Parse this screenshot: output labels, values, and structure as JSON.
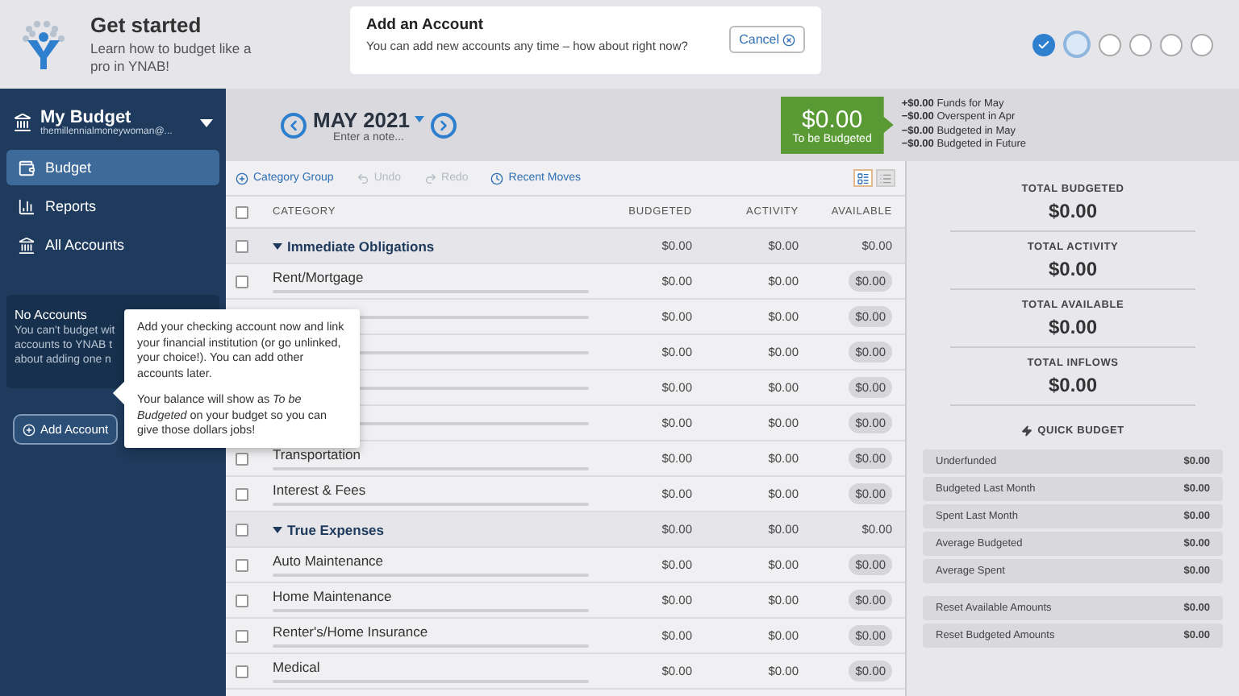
{
  "onboarding": {
    "title": "Get started",
    "subtitle": "Learn how to budget like a pro in YNAB!"
  },
  "banner": {
    "title": "Add an Account",
    "text": "You can add new accounts any time – how about right now?",
    "button": "Cancel"
  },
  "steps": [
    {
      "done": true,
      "selected": false
    },
    {
      "done": false,
      "selected": true
    },
    {
      "done": false,
      "selected": false
    },
    {
      "done": false,
      "selected": false
    },
    {
      "done": false,
      "selected": false
    },
    {
      "done": false,
      "selected": false
    }
  ],
  "sidebar": {
    "budget_name": "My Budget",
    "email": "themillennialmoneywoman@...",
    "items": [
      {
        "label": "Budget",
        "selected": true
      },
      {
        "label": "Reports",
        "selected": false
      },
      {
        "label": "All Accounts",
        "selected": false
      }
    ],
    "accounts_title": "No Accounts",
    "accounts_lines": [
      "You can't budget wit",
      "accounts to YNAB t",
      "about adding one n"
    ],
    "add_button": "Add Account"
  },
  "tooltip": {
    "paragraphs": [
      "Add your checking account now and link your financial institution (or go unlinked, your choice!). You can add other accounts later.",
      "Your balance will show as *To be Budgeted* on your budget so you can give those dollars jobs!"
    ]
  },
  "month": {
    "label": "MAY 2021",
    "note": "Enter a note..."
  },
  "to_be_budgeted": {
    "amount": "$0.00",
    "label": "To be Budgeted"
  },
  "breakdown": [
    {
      "amount": "+$0.00",
      "label": "Funds for May"
    },
    {
      "amount": "−$0.00",
      "label": "Overspent in Apr"
    },
    {
      "amount": "−$0.00",
      "label": "Budgeted in May"
    },
    {
      "amount": "−$0.00",
      "label": "Budgeted in Future"
    }
  ],
  "toolbar": [
    {
      "label": "Category Group",
      "disabled": false
    },
    {
      "label": "Undo",
      "disabled": true
    },
    {
      "label": "Redo",
      "disabled": true
    },
    {
      "label": "Recent Moves",
      "disabled": false
    }
  ],
  "view_toggle": [
    {
      "selected": true
    },
    {
      "selected": false
    }
  ],
  "table": {
    "select_all_checked": false,
    "columns": [
      "CATEGORY",
      "BUDGETED",
      "ACTIVITY",
      "AVAILABLE"
    ],
    "rows": [
      {
        "kind": "group",
        "checked": false,
        "name": "Immediate Obligations",
        "budgeted": "$0.00",
        "activity": "$0.00",
        "available": "$0.00"
      },
      {
        "kind": "category",
        "checked": false,
        "name": "Rent/Mortgage",
        "budgeted": "$0.00",
        "activity": "$0.00",
        "available": "$0.00"
      },
      {
        "kind": "category",
        "budgeted": "$0.00",
        "activity": "$0.00",
        "available": "$0.00"
      },
      {
        "kind": "category",
        "budgeted": "$0.00",
        "activity": "$0.00",
        "available": "$0.00"
      },
      {
        "kind": "category",
        "budgeted": "$0.00",
        "activity": "$0.00",
        "available": "$0.00"
      },
      {
        "kind": "category",
        "budgeted": "$0.00",
        "activity": "$0.00",
        "available": "$0.00"
      },
      {
        "kind": "category",
        "checked": false,
        "name": "Transportation",
        "budgeted": "$0.00",
        "activity": "$0.00",
        "available": "$0.00"
      },
      {
        "kind": "category",
        "checked": false,
        "name": "Interest & Fees",
        "budgeted": "$0.00",
        "activity": "$0.00",
        "available": "$0.00"
      },
      {
        "kind": "group",
        "checked": false,
        "name": "True Expenses",
        "budgeted": "$0.00",
        "activity": "$0.00",
        "available": "$0.00"
      },
      {
        "kind": "category",
        "checked": false,
        "name": "Auto Maintenance",
        "budgeted": "$0.00",
        "activity": "$0.00",
        "available": "$0.00"
      },
      {
        "kind": "category",
        "checked": false,
        "name": "Home Maintenance",
        "budgeted": "$0.00",
        "activity": "$0.00",
        "available": "$0.00"
      },
      {
        "kind": "category",
        "checked": false,
        "name": "Renter's/Home Insurance",
        "budgeted": "$0.00",
        "activity": "$0.00",
        "available": "$0.00"
      },
      {
        "kind": "category",
        "checked": false,
        "name": "Medical",
        "budgeted": "$0.00",
        "activity": "$0.00",
        "available": "$0.00"
      }
    ]
  },
  "totals": [
    {
      "label": "TOTAL BUDGETED",
      "value": "$0.00"
    },
    {
      "label": "TOTAL ACTIVITY",
      "value": "$0.00"
    },
    {
      "label": "TOTAL AVAILABLE",
      "value": "$0.00"
    },
    {
      "label": "TOTAL INFLOWS",
      "value": "$0.00"
    }
  ],
  "quick_budget": {
    "title": "QUICK BUDGET",
    "items": [
      {
        "label": "Underfunded",
        "value": "$0.00"
      },
      {
        "label": "Budgeted Last Month",
        "value": "$0.00"
      },
      {
        "label": "Spent Last Month",
        "value": "$0.00"
      },
      {
        "label": "Average Budgeted",
        "value": "$0.00"
      },
      {
        "label": "Average Spent",
        "value": "$0.00"
      }
    ],
    "resets": [
      {
        "label": "Reset Available Amounts",
        "value": "$0.00"
      },
      {
        "label": "Reset Budgeted Amounts",
        "value": "$0.00"
      }
    ]
  }
}
